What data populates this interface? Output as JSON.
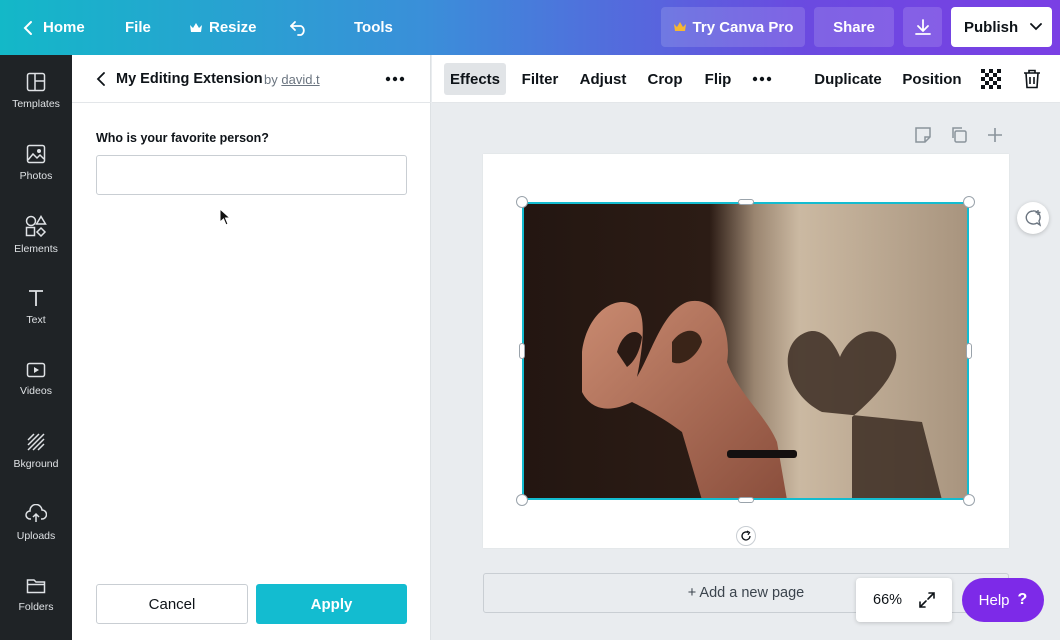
{
  "topbar": {
    "home_label": "Home",
    "file_label": "File",
    "resize_label": "Resize",
    "tools_label": "Tools",
    "try_pro_label": "Try Canva Pro",
    "share_label": "Share",
    "publish_label": "Publish"
  },
  "rail": {
    "items": [
      {
        "label": "Templates",
        "icon": "templates-icon"
      },
      {
        "label": "Photos",
        "icon": "photos-icon"
      },
      {
        "label": "Elements",
        "icon": "elements-icon"
      },
      {
        "label": "Text",
        "icon": "text-icon"
      },
      {
        "label": "Videos",
        "icon": "videos-icon"
      },
      {
        "label": "Bkground",
        "icon": "background-icon"
      },
      {
        "label": "Uploads",
        "icon": "uploads-icon"
      },
      {
        "label": "Folders",
        "icon": "folders-icon"
      }
    ]
  },
  "panel": {
    "title": "My Editing Extension",
    "by": "by",
    "author": "david.t",
    "field_label": "Who is your favorite person?",
    "field_value": "",
    "cancel_label": "Cancel",
    "apply_label": "Apply"
  },
  "toolbar": {
    "effects": "Effects",
    "filter": "Filter",
    "adjust": "Adjust",
    "crop": "Crop",
    "flip": "Flip",
    "duplicate": "Duplicate",
    "position": "Position"
  },
  "canvas": {
    "add_page_label": "+ Add a new page",
    "zoom_label": "66%",
    "help_label": "Help",
    "help_mark": "?"
  },
  "colors": {
    "accent": "#13bcd0",
    "help": "#7d2ae8",
    "crown": "#f7b731"
  }
}
